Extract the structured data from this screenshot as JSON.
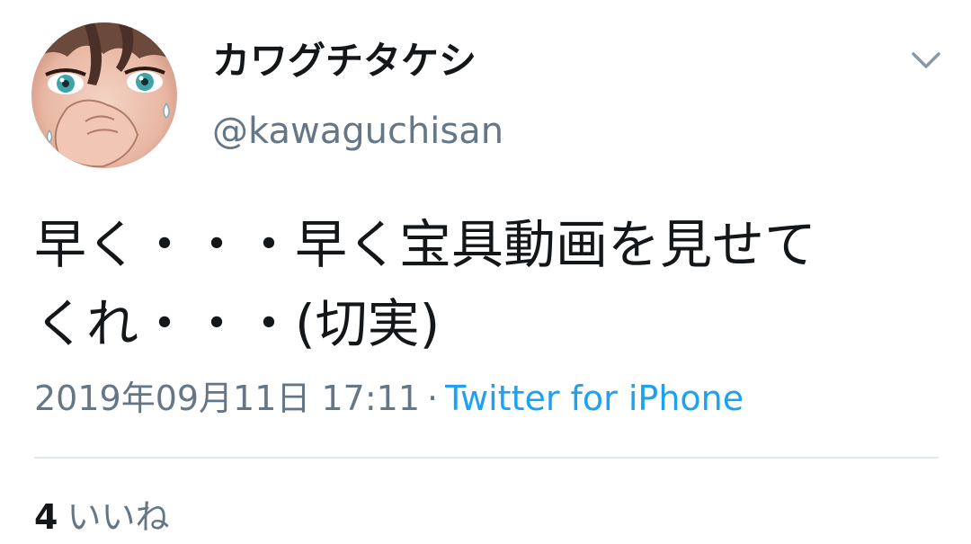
{
  "user": {
    "display_name": "カワグチタケシ",
    "handle": "@kawaguchisan"
  },
  "tweet": {
    "text_line1": "早く・・・早く宝具動画を見せて",
    "text_line2": "くれ・・・(切実)",
    "timestamp": "2019年09月11日 17:11",
    "separator": "·",
    "source": "Twitter for iPhone"
  },
  "stats": {
    "likes_count": "4",
    "likes_label": "いいね"
  },
  "icons": {
    "menu": "chevron-down-icon"
  },
  "colors": {
    "text": "#14171a",
    "secondary": "#657786",
    "link": "#1da1f2",
    "divider": "#e1e8ed"
  }
}
